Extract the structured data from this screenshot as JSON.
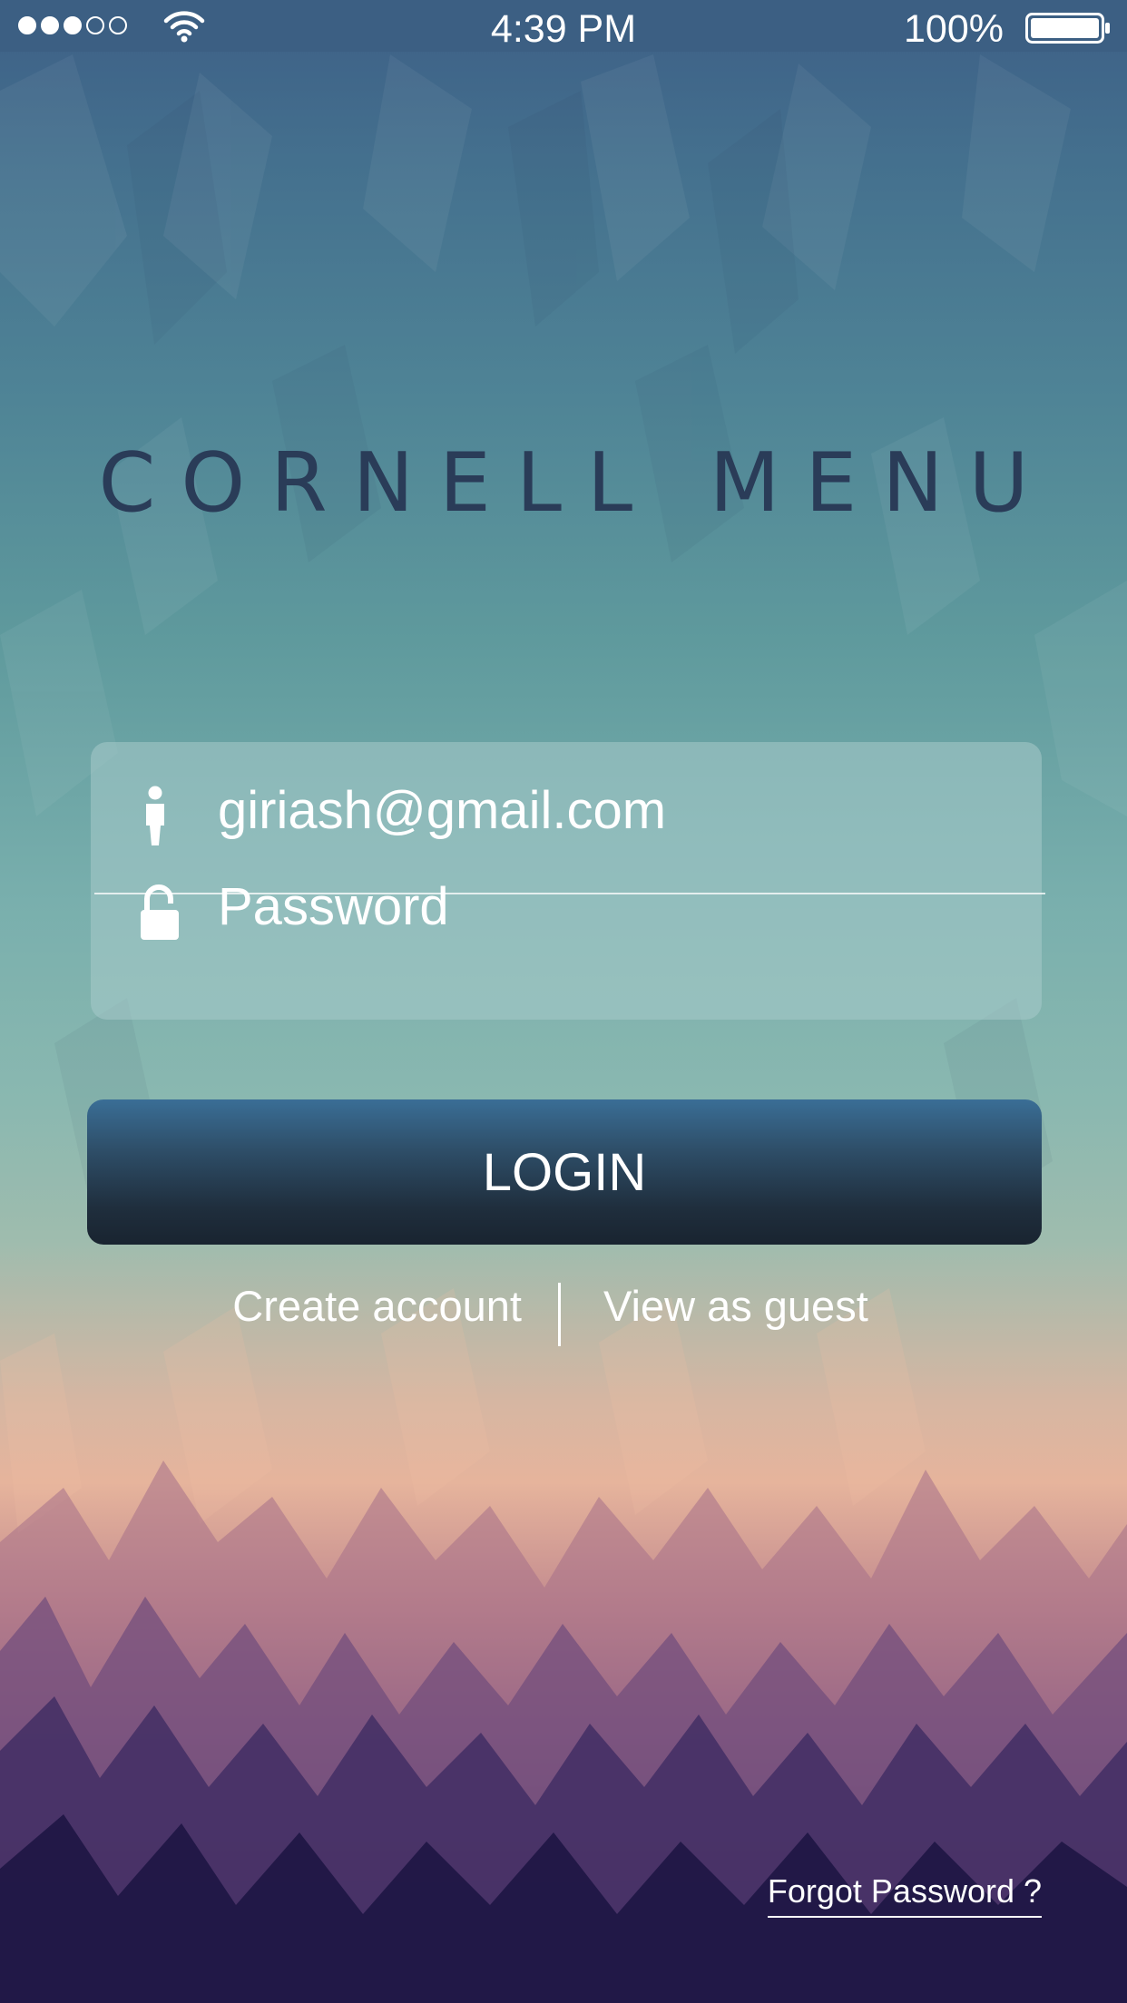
{
  "status_bar": {
    "time": "4:39 PM",
    "battery_percent": "100%",
    "signal_bars_filled": 3,
    "signal_bars_total": 5,
    "battery_level": 1.0
  },
  "app": {
    "title": "CORNELL MENU"
  },
  "login_form": {
    "email_value": "giriash@gmail.com",
    "password_placeholder": "Password",
    "user_icon": "user-icon",
    "lock_icon": "lock-icon"
  },
  "actions": {
    "login_label": "LOGIN",
    "create_account_label": "Create account",
    "guest_label": "View as guest",
    "forgot_password_label": "Forgot Password ?"
  },
  "colors": {
    "title": "#2a3c58",
    "status_bar": "#3c5f83",
    "button_top": "#3a6e96",
    "button_bottom": "#192430"
  }
}
